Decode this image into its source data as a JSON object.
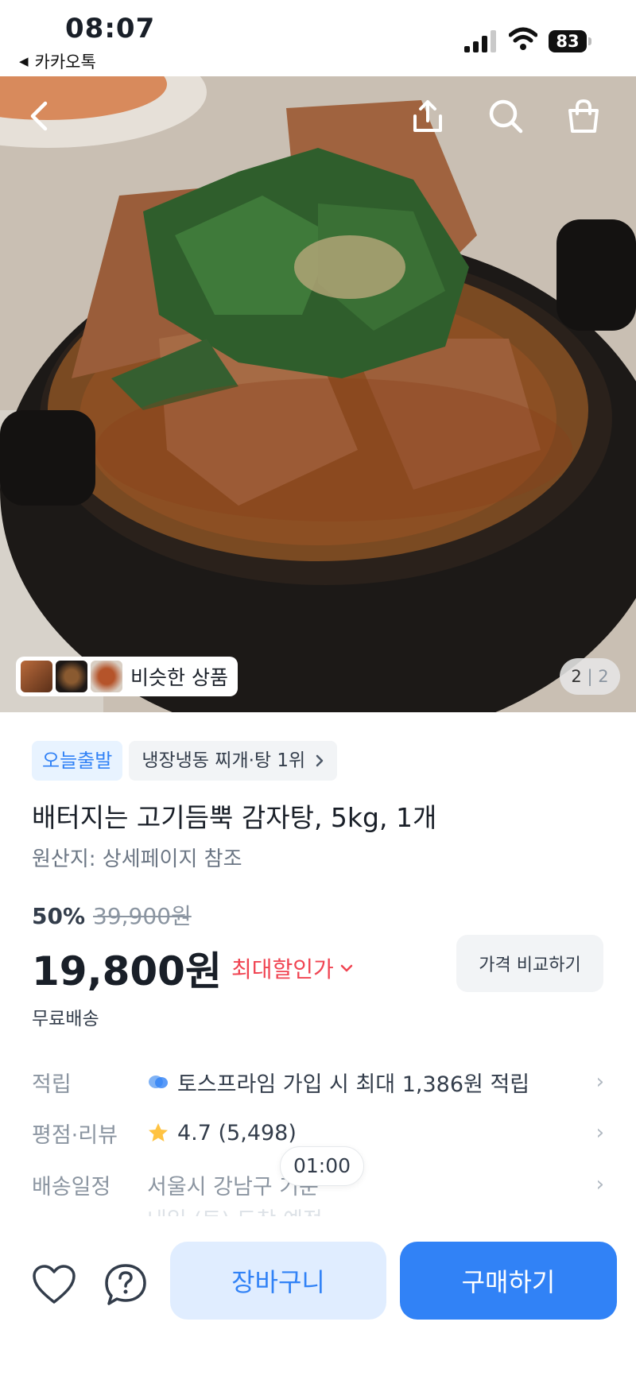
{
  "status_bar": {
    "time": "08:07",
    "back_app": "카카오톡",
    "battery": "83"
  },
  "hero": {
    "similar_label": "비슷한 상품",
    "pager_current": "2",
    "pager_separator": "|",
    "pager_total": "2"
  },
  "product": {
    "badge_today": "오늘출발",
    "rank_badge": "냉장냉동 찌개·탕 1위",
    "title": "배터지는 고기듬뿍 감자탕, 5kg, 1개",
    "origin": "원산지: 상세페이지 참조",
    "discount_rate": "50%",
    "original_price": "39,900원",
    "price": "19,800원",
    "max_discount_label": "최대할인가",
    "compare_label": "가격 비교하기",
    "shipping": "무료배송"
  },
  "info_rows": {
    "points_label": "적립",
    "points_value": "토스프라임 가입 시 최대 1,386원 적립",
    "rating_label": "평점·리뷰",
    "rating_value": "4.7 (5,498)",
    "delivery_label": "배송일정",
    "delivery_value": "서울시 강남구 기준",
    "delivery_eta": "내일 (토) 도착 예정",
    "timer": "01:00"
  },
  "bottom_bar": {
    "cart_label": "장바구니",
    "buy_label": "구매하기"
  },
  "colors": {
    "accent": "#3182f6",
    "accent_light": "#e0edff",
    "discount_red": "#f04452",
    "star": "#ffc342"
  }
}
